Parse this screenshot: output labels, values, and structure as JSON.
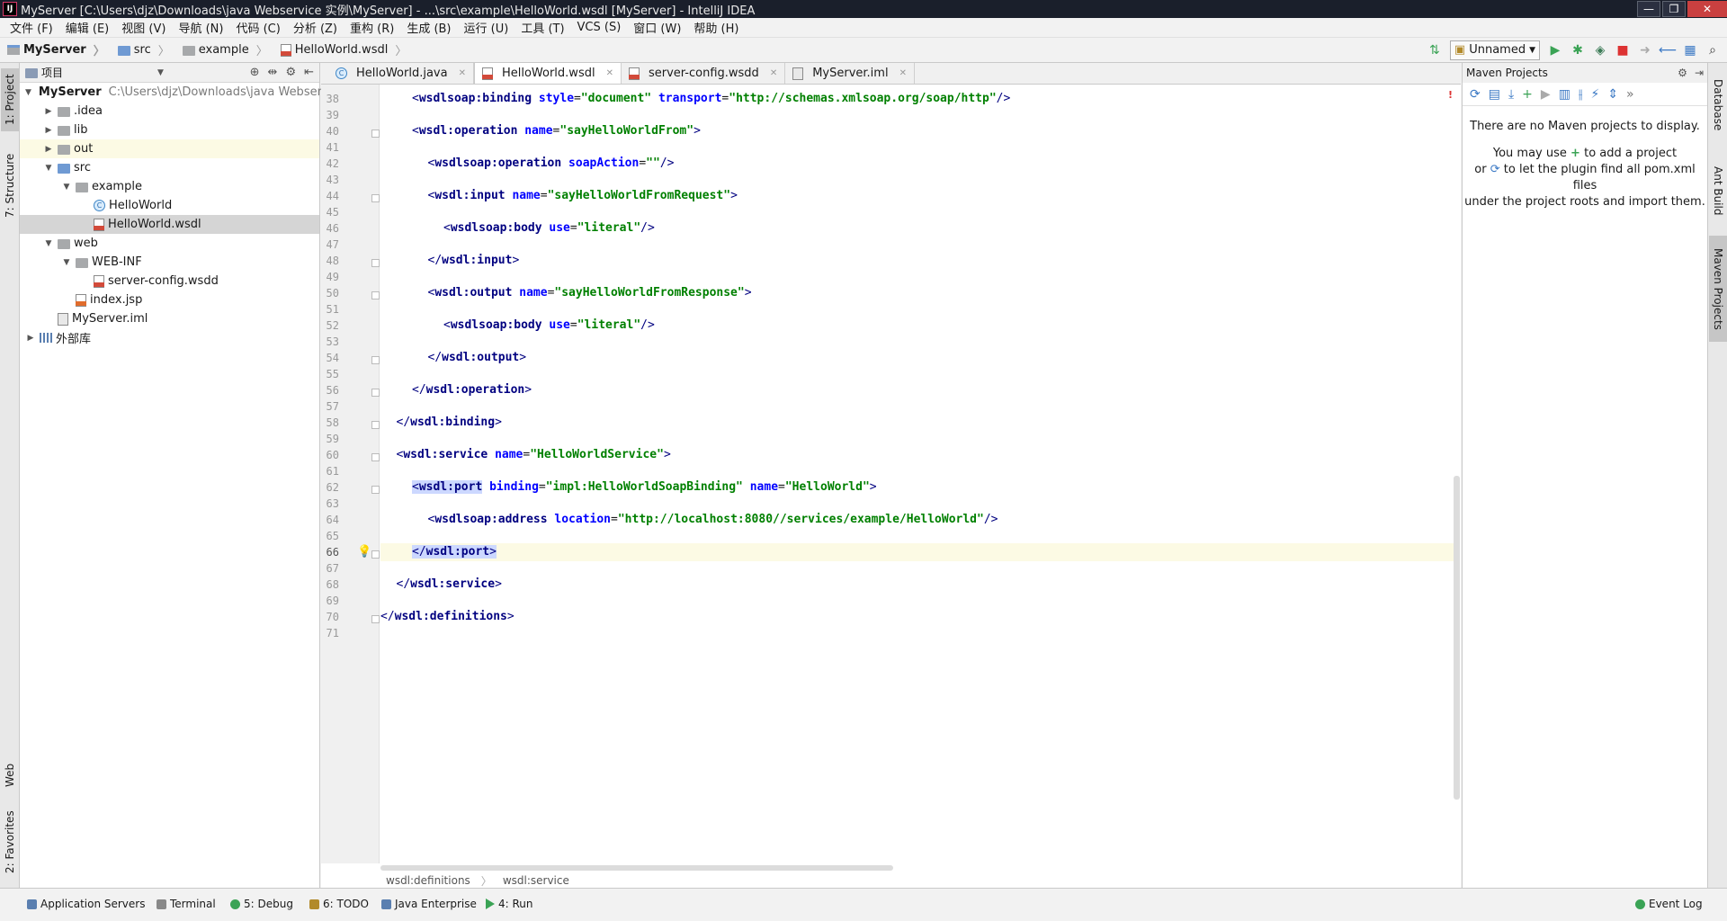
{
  "window": {
    "title": "MyServer [C:\\Users\\djz\\Downloads\\java Webservice 实例\\MyServer] - ...\\src\\example\\HelloWorld.wsdl [MyServer] - IntelliJ IDEA",
    "minimize": "—",
    "maximize": "❐",
    "close": "✕"
  },
  "menu": [
    "文件 (F)",
    "编辑 (E)",
    "视图 (V)",
    "导航 (N)",
    "代码 (C)",
    "分析 (Z)",
    "重构 (R)",
    "生成 (B)",
    "运行 (U)",
    "工具 (T)",
    "VCS (S)",
    "窗口 (W)",
    "帮助 (H)"
  ],
  "breadcrumb": [
    "MyServer",
    "src",
    "example",
    "HelloWorld.wsdl"
  ],
  "run_config": "Unnamed",
  "left_tabs": [
    "1: Project",
    "7: Structure",
    "Web",
    "2: Favorites"
  ],
  "right_tabs": [
    "Database",
    "Ant Build",
    "Maven Projects"
  ],
  "project_panel": {
    "title": "项目",
    "tree": [
      {
        "label": "MyServer",
        "hint": "C:\\Users\\djz\\Downloads\\java Webservic",
        "depth": 0,
        "arrow": "open",
        "icon": "module"
      },
      {
        "label": ".idea",
        "depth": 1,
        "arrow": "closed",
        "icon": "folder"
      },
      {
        "label": "lib",
        "depth": 1,
        "arrow": "closed",
        "icon": "folder"
      },
      {
        "label": "out",
        "depth": 1,
        "arrow": "closed",
        "icon": "folder"
      },
      {
        "label": "src",
        "depth": 1,
        "arrow": "open",
        "icon": "folder-blue"
      },
      {
        "label": "example",
        "depth": 2,
        "arrow": "open",
        "icon": "folder"
      },
      {
        "label": "HelloWorld",
        "depth": 3,
        "arrow": "none",
        "icon": "java"
      },
      {
        "label": "HelloWorld.wsdl",
        "depth": 3,
        "arrow": "none",
        "icon": "wsdl"
      },
      {
        "label": "web",
        "depth": 1,
        "arrow": "open",
        "icon": "folder"
      },
      {
        "label": "WEB-INF",
        "depth": 2,
        "arrow": "open",
        "icon": "folder"
      },
      {
        "label": "server-config.wsdd",
        "depth": 3,
        "arrow": "none",
        "icon": "wsdl"
      },
      {
        "label": "index.jsp",
        "depth": 2,
        "arrow": "none",
        "icon": "jsp"
      },
      {
        "label": "MyServer.iml",
        "depth": 1,
        "arrow": "none",
        "icon": "iml"
      },
      {
        "label": "外部库",
        "depth": 0,
        "arrow": "closed",
        "icon": "lib"
      }
    ]
  },
  "editor_tabs": [
    {
      "label": "HelloWorld.java",
      "active": false
    },
    {
      "label": "HelloWorld.wsdl",
      "active": true
    },
    {
      "label": "server-config.wsdd",
      "active": false
    },
    {
      "label": "MyServer.iml",
      "active": false
    }
  ],
  "code_lines": [
    {
      "n": "38",
      "indent": 2,
      "tokens": [
        [
          "b",
          "<"
        ],
        [
          "t",
          "wsdlsoap:binding"
        ],
        [
          "p",
          " "
        ],
        [
          "a",
          "style"
        ],
        [
          "p",
          "="
        ],
        [
          "v",
          "\"document\""
        ],
        [
          "p",
          " "
        ],
        [
          "a",
          "transport"
        ],
        [
          "p",
          "="
        ],
        [
          "v",
          "\"http://schemas.xmlsoap.org/soap/http\""
        ],
        [
          "b",
          "/>"
        ]
      ]
    },
    {
      "n": "39",
      "indent": 0,
      "tokens": []
    },
    {
      "n": "40",
      "indent": 2,
      "tokens": [
        [
          "b",
          "<"
        ],
        [
          "t",
          "wsdl:operation"
        ],
        [
          "p",
          " "
        ],
        [
          "a",
          "name"
        ],
        [
          "p",
          "="
        ],
        [
          "v",
          "\"sayHelloWorldFrom\""
        ],
        [
          "b",
          ">"
        ]
      ]
    },
    {
      "n": "41",
      "indent": 0,
      "tokens": []
    },
    {
      "n": "42",
      "indent": 3,
      "tokens": [
        [
          "b",
          "<"
        ],
        [
          "t",
          "wsdlsoap:operation"
        ],
        [
          "p",
          " "
        ],
        [
          "a",
          "soapAction"
        ],
        [
          "p",
          "="
        ],
        [
          "v",
          "\"\""
        ],
        [
          "b",
          "/>"
        ]
      ]
    },
    {
      "n": "43",
      "indent": 0,
      "tokens": []
    },
    {
      "n": "44",
      "indent": 3,
      "tokens": [
        [
          "b",
          "<"
        ],
        [
          "t",
          "wsdl:input"
        ],
        [
          "p",
          " "
        ],
        [
          "a",
          "name"
        ],
        [
          "p",
          "="
        ],
        [
          "v",
          "\"sayHelloWorldFromRequest\""
        ],
        [
          "b",
          ">"
        ]
      ]
    },
    {
      "n": "45",
      "indent": 0,
      "tokens": []
    },
    {
      "n": "46",
      "indent": 4,
      "tokens": [
        [
          "b",
          "<"
        ],
        [
          "t",
          "wsdlsoap:body"
        ],
        [
          "p",
          " "
        ],
        [
          "a",
          "use"
        ],
        [
          "p",
          "="
        ],
        [
          "v",
          "\"literal\""
        ],
        [
          "b",
          "/>"
        ]
      ]
    },
    {
      "n": "47",
      "indent": 0,
      "tokens": []
    },
    {
      "n": "48",
      "indent": 3,
      "tokens": [
        [
          "b",
          "</"
        ],
        [
          "t",
          "wsdl:input"
        ],
        [
          "b",
          ">"
        ]
      ]
    },
    {
      "n": "49",
      "indent": 0,
      "tokens": []
    },
    {
      "n": "50",
      "indent": 3,
      "tokens": [
        [
          "b",
          "<"
        ],
        [
          "t",
          "wsdl:output"
        ],
        [
          "p",
          " "
        ],
        [
          "a",
          "name"
        ],
        [
          "p",
          "="
        ],
        [
          "v",
          "\"sayHelloWorldFromResponse\""
        ],
        [
          "b",
          ">"
        ]
      ]
    },
    {
      "n": "51",
      "indent": 0,
      "tokens": []
    },
    {
      "n": "52",
      "indent": 4,
      "tokens": [
        [
          "b",
          "<"
        ],
        [
          "t",
          "wsdlsoap:body"
        ],
        [
          "p",
          " "
        ],
        [
          "a",
          "use"
        ],
        [
          "p",
          "="
        ],
        [
          "v",
          "\"literal\""
        ],
        [
          "b",
          "/>"
        ]
      ]
    },
    {
      "n": "53",
      "indent": 0,
      "tokens": []
    },
    {
      "n": "54",
      "indent": 3,
      "tokens": [
        [
          "b",
          "</"
        ],
        [
          "t",
          "wsdl:output"
        ],
        [
          "b",
          ">"
        ]
      ]
    },
    {
      "n": "55",
      "indent": 0,
      "tokens": []
    },
    {
      "n": "56",
      "indent": 2,
      "tokens": [
        [
          "b",
          "</"
        ],
        [
          "t",
          "wsdl:operation"
        ],
        [
          "b",
          ">"
        ]
      ]
    },
    {
      "n": "57",
      "indent": 0,
      "tokens": []
    },
    {
      "n": "58",
      "indent": 1,
      "tokens": [
        [
          "b",
          "</"
        ],
        [
          "t",
          "wsdl:binding"
        ],
        [
          "b",
          ">"
        ]
      ]
    },
    {
      "n": "59",
      "indent": 0,
      "tokens": []
    },
    {
      "n": "60",
      "indent": 1,
      "tokens": [
        [
          "b",
          "<"
        ],
        [
          "t",
          "wsdl:service"
        ],
        [
          "p",
          " "
        ],
        [
          "a",
          "name"
        ],
        [
          "p",
          "="
        ],
        [
          "v",
          "\"HelloWorldService\""
        ],
        [
          "b",
          ">"
        ]
      ]
    },
    {
      "n": "61",
      "indent": 0,
      "tokens": []
    },
    {
      "n": "62",
      "indent": 2,
      "tokens": [
        [
          "bs",
          "<"
        ],
        [
          "ts",
          "wsdl:port"
        ],
        [
          "p",
          " "
        ],
        [
          "a",
          "binding"
        ],
        [
          "p",
          "="
        ],
        [
          "v",
          "\"impl:HelloWorldSoapBinding\""
        ],
        [
          "p",
          " "
        ],
        [
          "a",
          "name"
        ],
        [
          "p",
          "="
        ],
        [
          "v",
          "\"HelloWorld\""
        ],
        [
          "b",
          ">"
        ]
      ]
    },
    {
      "n": "63",
      "indent": 0,
      "tokens": []
    },
    {
      "n": "64",
      "indent": 3,
      "tokens": [
        [
          "b",
          "<"
        ],
        [
          "t",
          "wsdlsoap:address"
        ],
        [
          "p",
          " "
        ],
        [
          "a",
          "location"
        ],
        [
          "p",
          "="
        ],
        [
          "v",
          "\"http://localhost:8080//services/example/HelloWorld\""
        ],
        [
          "b",
          "/>"
        ]
      ]
    },
    {
      "n": "65",
      "indent": 0,
      "tokens": []
    },
    {
      "n": "66",
      "indent": 2,
      "current": true,
      "tokens": [
        [
          "bs",
          "</"
        ],
        [
          "ts",
          "wsdl:port"
        ],
        [
          "bs",
          ">"
        ]
      ]
    },
    {
      "n": "67",
      "indent": 0,
      "tokens": []
    },
    {
      "n": "68",
      "indent": 1,
      "tokens": [
        [
          "b",
          "</"
        ],
        [
          "t",
          "wsdl:service"
        ],
        [
          "b",
          ">"
        ]
      ]
    },
    {
      "n": "69",
      "indent": 0,
      "tokens": []
    },
    {
      "n": "70",
      "indent": 0,
      "tokens": [
        [
          "b",
          "</"
        ],
        [
          "t",
          "wsdl:definitions"
        ],
        [
          "b",
          ">"
        ]
      ]
    },
    {
      "n": "71",
      "indent": 0,
      "tokens": []
    }
  ],
  "editor_breadcrumbs": [
    "wsdl:definitions",
    "wsdl:service"
  ],
  "maven": {
    "title": "Maven Projects",
    "msg1": "There are no Maven projects to display.",
    "msg2a": "You may use",
    "msg2b": "to add a project",
    "msg3a": "or",
    "msg3b": "to let the plugin find all pom.xml files",
    "msg4": "under the project roots and import them."
  },
  "status_tools": [
    {
      "label": "Application Servers",
      "icon": "blue"
    },
    {
      "label": "Terminal",
      "icon": "gray"
    },
    {
      "label": "5: Debug",
      "icon": "green"
    },
    {
      "label": "6: TODO",
      "icon": "yellow"
    },
    {
      "label": "Java Enterprise",
      "icon": "blue"
    },
    {
      "label": "4: Run",
      "icon": "play"
    }
  ],
  "event_log": "Event Log"
}
